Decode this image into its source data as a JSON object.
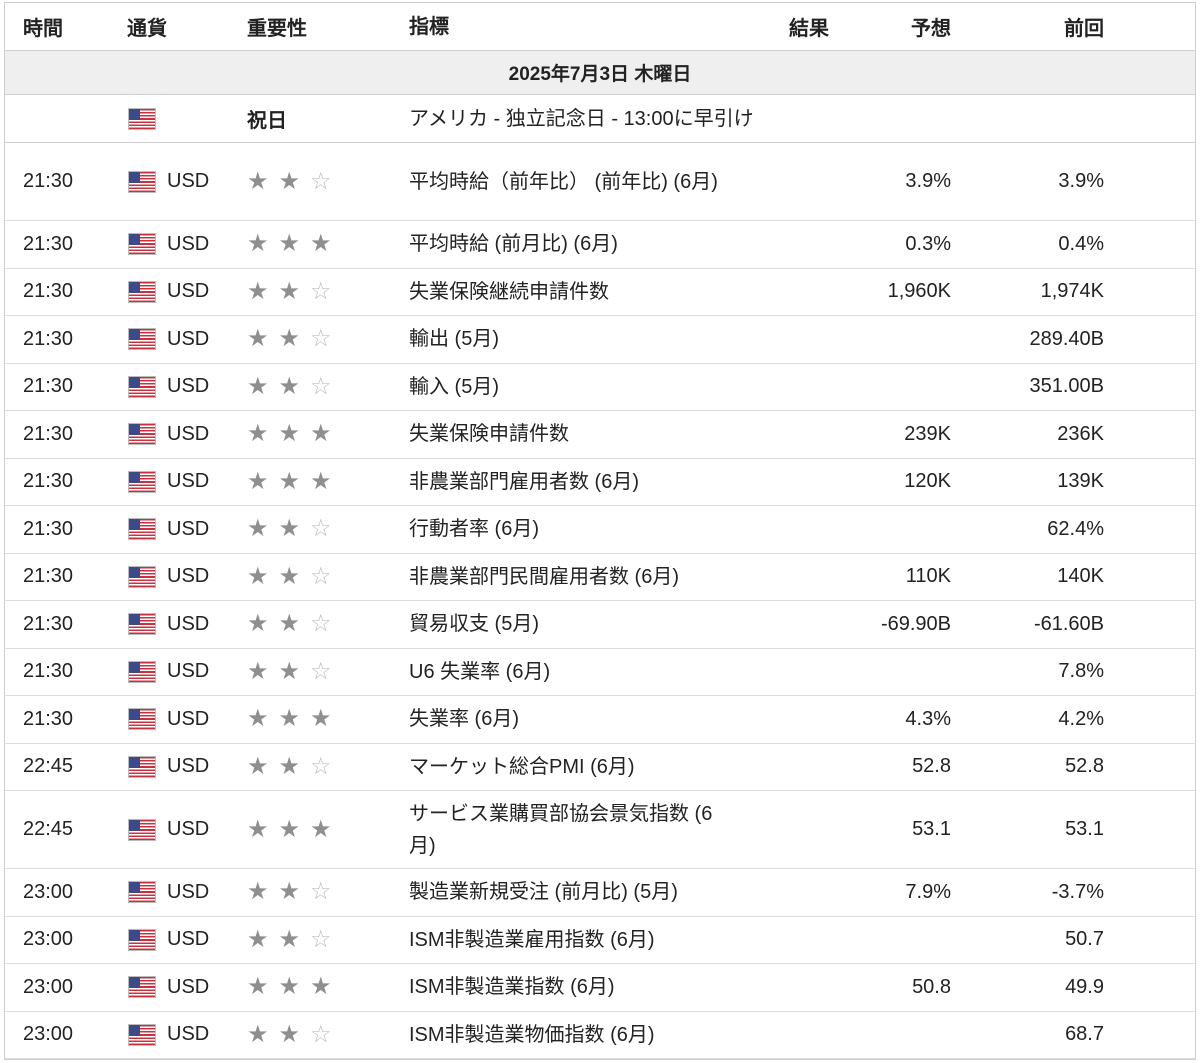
{
  "header": {
    "time": "時間",
    "currency": "通貨",
    "importance": "重要性",
    "indicator": "指標",
    "actual": "結果",
    "forecast": "予想",
    "previous": "前回"
  },
  "date_label": "2025年7月3日 木曜日",
  "holiday": {
    "label": "祝日",
    "text": "アメリカ - 独立記念日 - 13:00に早引け"
  },
  "events": [
    {
      "time": "21:30",
      "currency": "USD",
      "stars": 2,
      "indicator": "平均時給（前年比） (前年比) (6月)",
      "actual": "",
      "forecast": "3.9%",
      "previous": "3.9%",
      "tall": true
    },
    {
      "time": "21:30",
      "currency": "USD",
      "stars": 3,
      "indicator": "平均時給 (前月比) (6月)",
      "actual": "",
      "forecast": "0.3%",
      "previous": "0.4%"
    },
    {
      "time": "21:30",
      "currency": "USD",
      "stars": 2,
      "indicator": "失業保険継続申請件数",
      "actual": "",
      "forecast": "1,960K",
      "previous": "1,974K"
    },
    {
      "time": "21:30",
      "currency": "USD",
      "stars": 2,
      "indicator": "輸出 (5月)",
      "actual": "",
      "forecast": "",
      "previous": "289.40B"
    },
    {
      "time": "21:30",
      "currency": "USD",
      "stars": 2,
      "indicator": "輸入 (5月)",
      "actual": "",
      "forecast": "",
      "previous": "351.00B"
    },
    {
      "time": "21:30",
      "currency": "USD",
      "stars": 3,
      "indicator": "失業保険申請件数",
      "actual": "",
      "forecast": "239K",
      "previous": "236K"
    },
    {
      "time": "21:30",
      "currency": "USD",
      "stars": 3,
      "indicator": "非農業部門雇用者数 (6月)",
      "actual": "",
      "forecast": "120K",
      "previous": "139K"
    },
    {
      "time": "21:30",
      "currency": "USD",
      "stars": 2,
      "indicator": "行動者率 (6月)",
      "actual": "",
      "forecast": "",
      "previous": "62.4%"
    },
    {
      "time": "21:30",
      "currency": "USD",
      "stars": 2,
      "indicator": "非農業部門民間雇用者数 (6月)",
      "actual": "",
      "forecast": "110K",
      "previous": "140K"
    },
    {
      "time": "21:30",
      "currency": "USD",
      "stars": 2,
      "indicator": "貿易収支 (5月)",
      "actual": "",
      "forecast": "-69.90B",
      "previous": "-61.60B"
    },
    {
      "time": "21:30",
      "currency": "USD",
      "stars": 2,
      "indicator": "U6 失業率 (6月)",
      "actual": "",
      "forecast": "",
      "previous": "7.8%"
    },
    {
      "time": "21:30",
      "currency": "USD",
      "stars": 3,
      "indicator": "失業率 (6月)",
      "actual": "",
      "forecast": "4.3%",
      "previous": "4.2%"
    },
    {
      "time": "22:45",
      "currency": "USD",
      "stars": 2,
      "indicator": "マーケット総合PMI (6月)",
      "actual": "",
      "forecast": "52.8",
      "previous": "52.8"
    },
    {
      "time": "22:45",
      "currency": "USD",
      "stars": 3,
      "indicator": "サービス業購買部協会景気指数 (6月)",
      "actual": "",
      "forecast": "53.1",
      "previous": "53.1",
      "tall": true
    },
    {
      "time": "23:00",
      "currency": "USD",
      "stars": 2,
      "indicator": "製造業新規受注 (前月比) (5月)",
      "actual": "",
      "forecast": "7.9%",
      "previous": "-3.7%"
    },
    {
      "time": "23:00",
      "currency": "USD",
      "stars": 2,
      "indicator": "ISM非製造業雇用指数 (6月)",
      "actual": "",
      "forecast": "",
      "previous": "50.7"
    },
    {
      "time": "23:00",
      "currency": "USD",
      "stars": 3,
      "indicator": "ISM非製造業指数 (6月)",
      "actual": "",
      "forecast": "50.8",
      "previous": "49.9"
    },
    {
      "time": "23:00",
      "currency": "USD",
      "stars": 2,
      "indicator": "ISM非製造業物価指数 (6月)",
      "actual": "",
      "forecast": "",
      "previous": "68.7"
    }
  ],
  "colors": {
    "star_on": "#8f8f8f",
    "star_off": "#bdbdbd",
    "date_bg": "#efefef",
    "flag_red": "#c8323f",
    "flag_blue": "#3c4a8a"
  }
}
